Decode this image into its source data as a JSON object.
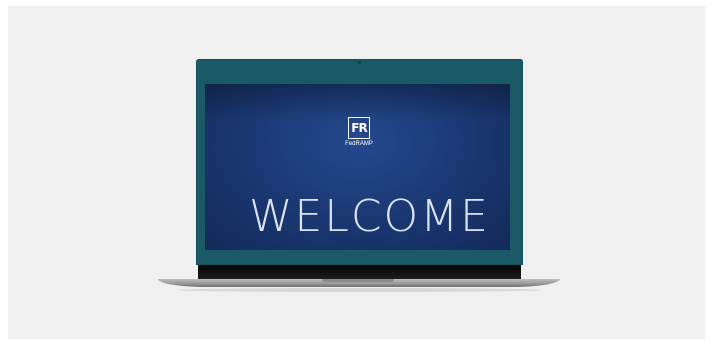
{
  "screen": {
    "logo": {
      "letters": "FR",
      "caption": "FedRAMP"
    },
    "headline": "WELCOME"
  },
  "colors": {
    "background": "#f0f0f0",
    "lid": "#195a66",
    "screen": "#1c3a77",
    "text": "#ffffff"
  },
  "icons": {
    "logo": "fedramp-logo-icon"
  }
}
